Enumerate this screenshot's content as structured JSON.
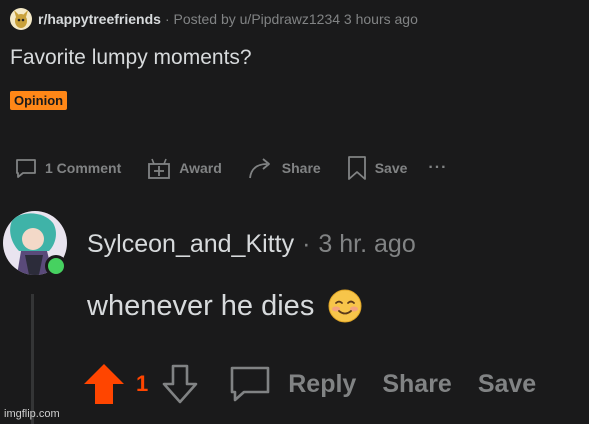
{
  "post": {
    "subreddit": "r/happytreefriends",
    "meta": "· Posted by u/Pipdrawz1234 3 hours ago",
    "title": "Favorite lumpy moments?",
    "flair": "Opinion",
    "actions": {
      "comments": "1 Comment",
      "award": "Award",
      "share": "Share",
      "save": "Save",
      "more": "···"
    }
  },
  "comment": {
    "author": "Sylceon_and_Kitty",
    "separator": "·",
    "time": "3 hr. ago",
    "text": "whenever he dies",
    "emoji": "smiling-face-icon",
    "votes": "1",
    "reply": "Reply",
    "share": "Share",
    "save": "Save"
  },
  "watermark": "imgflip.com",
  "colors": {
    "background": "#1a1a1b",
    "text": "#d7dadc",
    "muted": "#818384",
    "upvote": "#ff4500",
    "flair": "#ff8717",
    "online": "#46d160"
  }
}
